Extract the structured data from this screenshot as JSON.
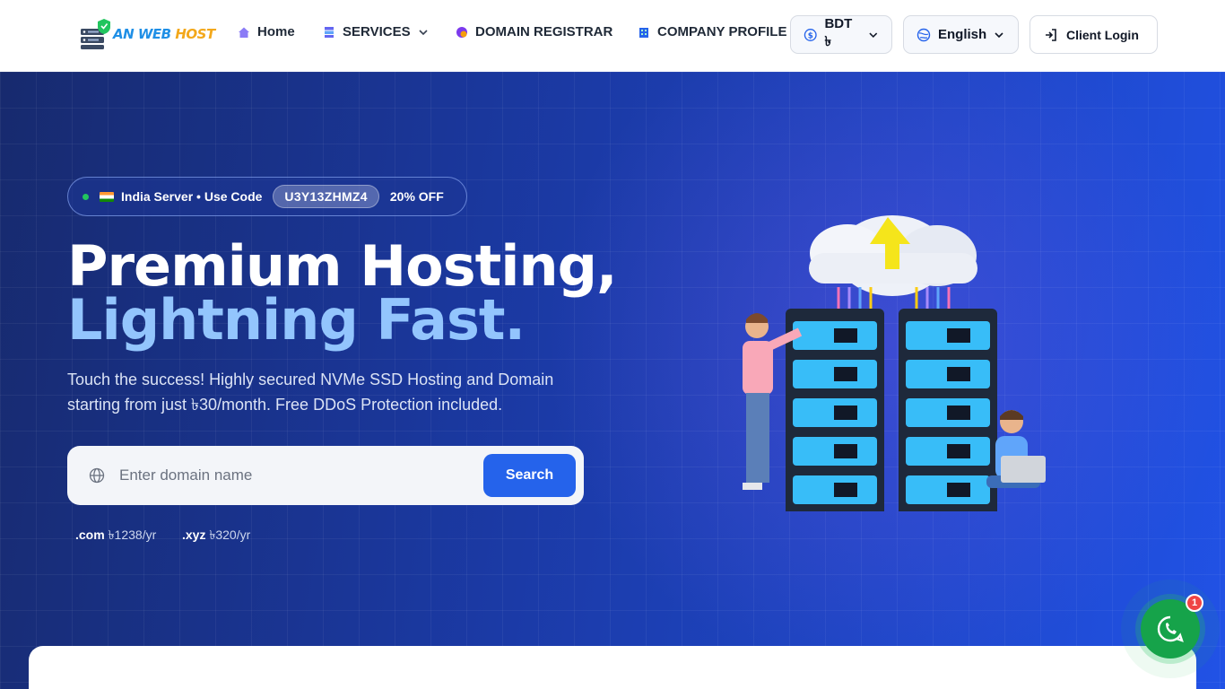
{
  "brand": {
    "name_part1": "AN WEB",
    "name_part2": "HOST"
  },
  "nav": {
    "home": "Home",
    "services": "SERVICES",
    "domain": "DOMAIN REGISTRAR",
    "company": "COMPANY PROFILE"
  },
  "header_actions": {
    "currency": "BDT ৳",
    "language": "English",
    "login": "Client Login"
  },
  "promo": {
    "text": "India Server • Use Code",
    "code": "U3Y13ZHMZ4",
    "discount": "20% OFF"
  },
  "hero": {
    "title_line1": "Premium Hosting,",
    "title_line2": "Lightning Fast.",
    "subtitle": "Touch the success! Highly secured NVMe SSD Hosting and Domain starting from just ৳30/month. Free DDoS Protection included."
  },
  "search": {
    "placeholder": "Enter domain name",
    "button": "Search"
  },
  "tlds": [
    {
      "ext": ".com",
      "price": "৳1238/yr"
    },
    {
      "ext": ".xyz",
      "price": "৳320/yr"
    }
  ],
  "whatsapp": {
    "badge": "1"
  },
  "colors": {
    "primary": "#2563eb",
    "accent_blue": "#93c5fd",
    "whatsapp": "#16a34a"
  }
}
